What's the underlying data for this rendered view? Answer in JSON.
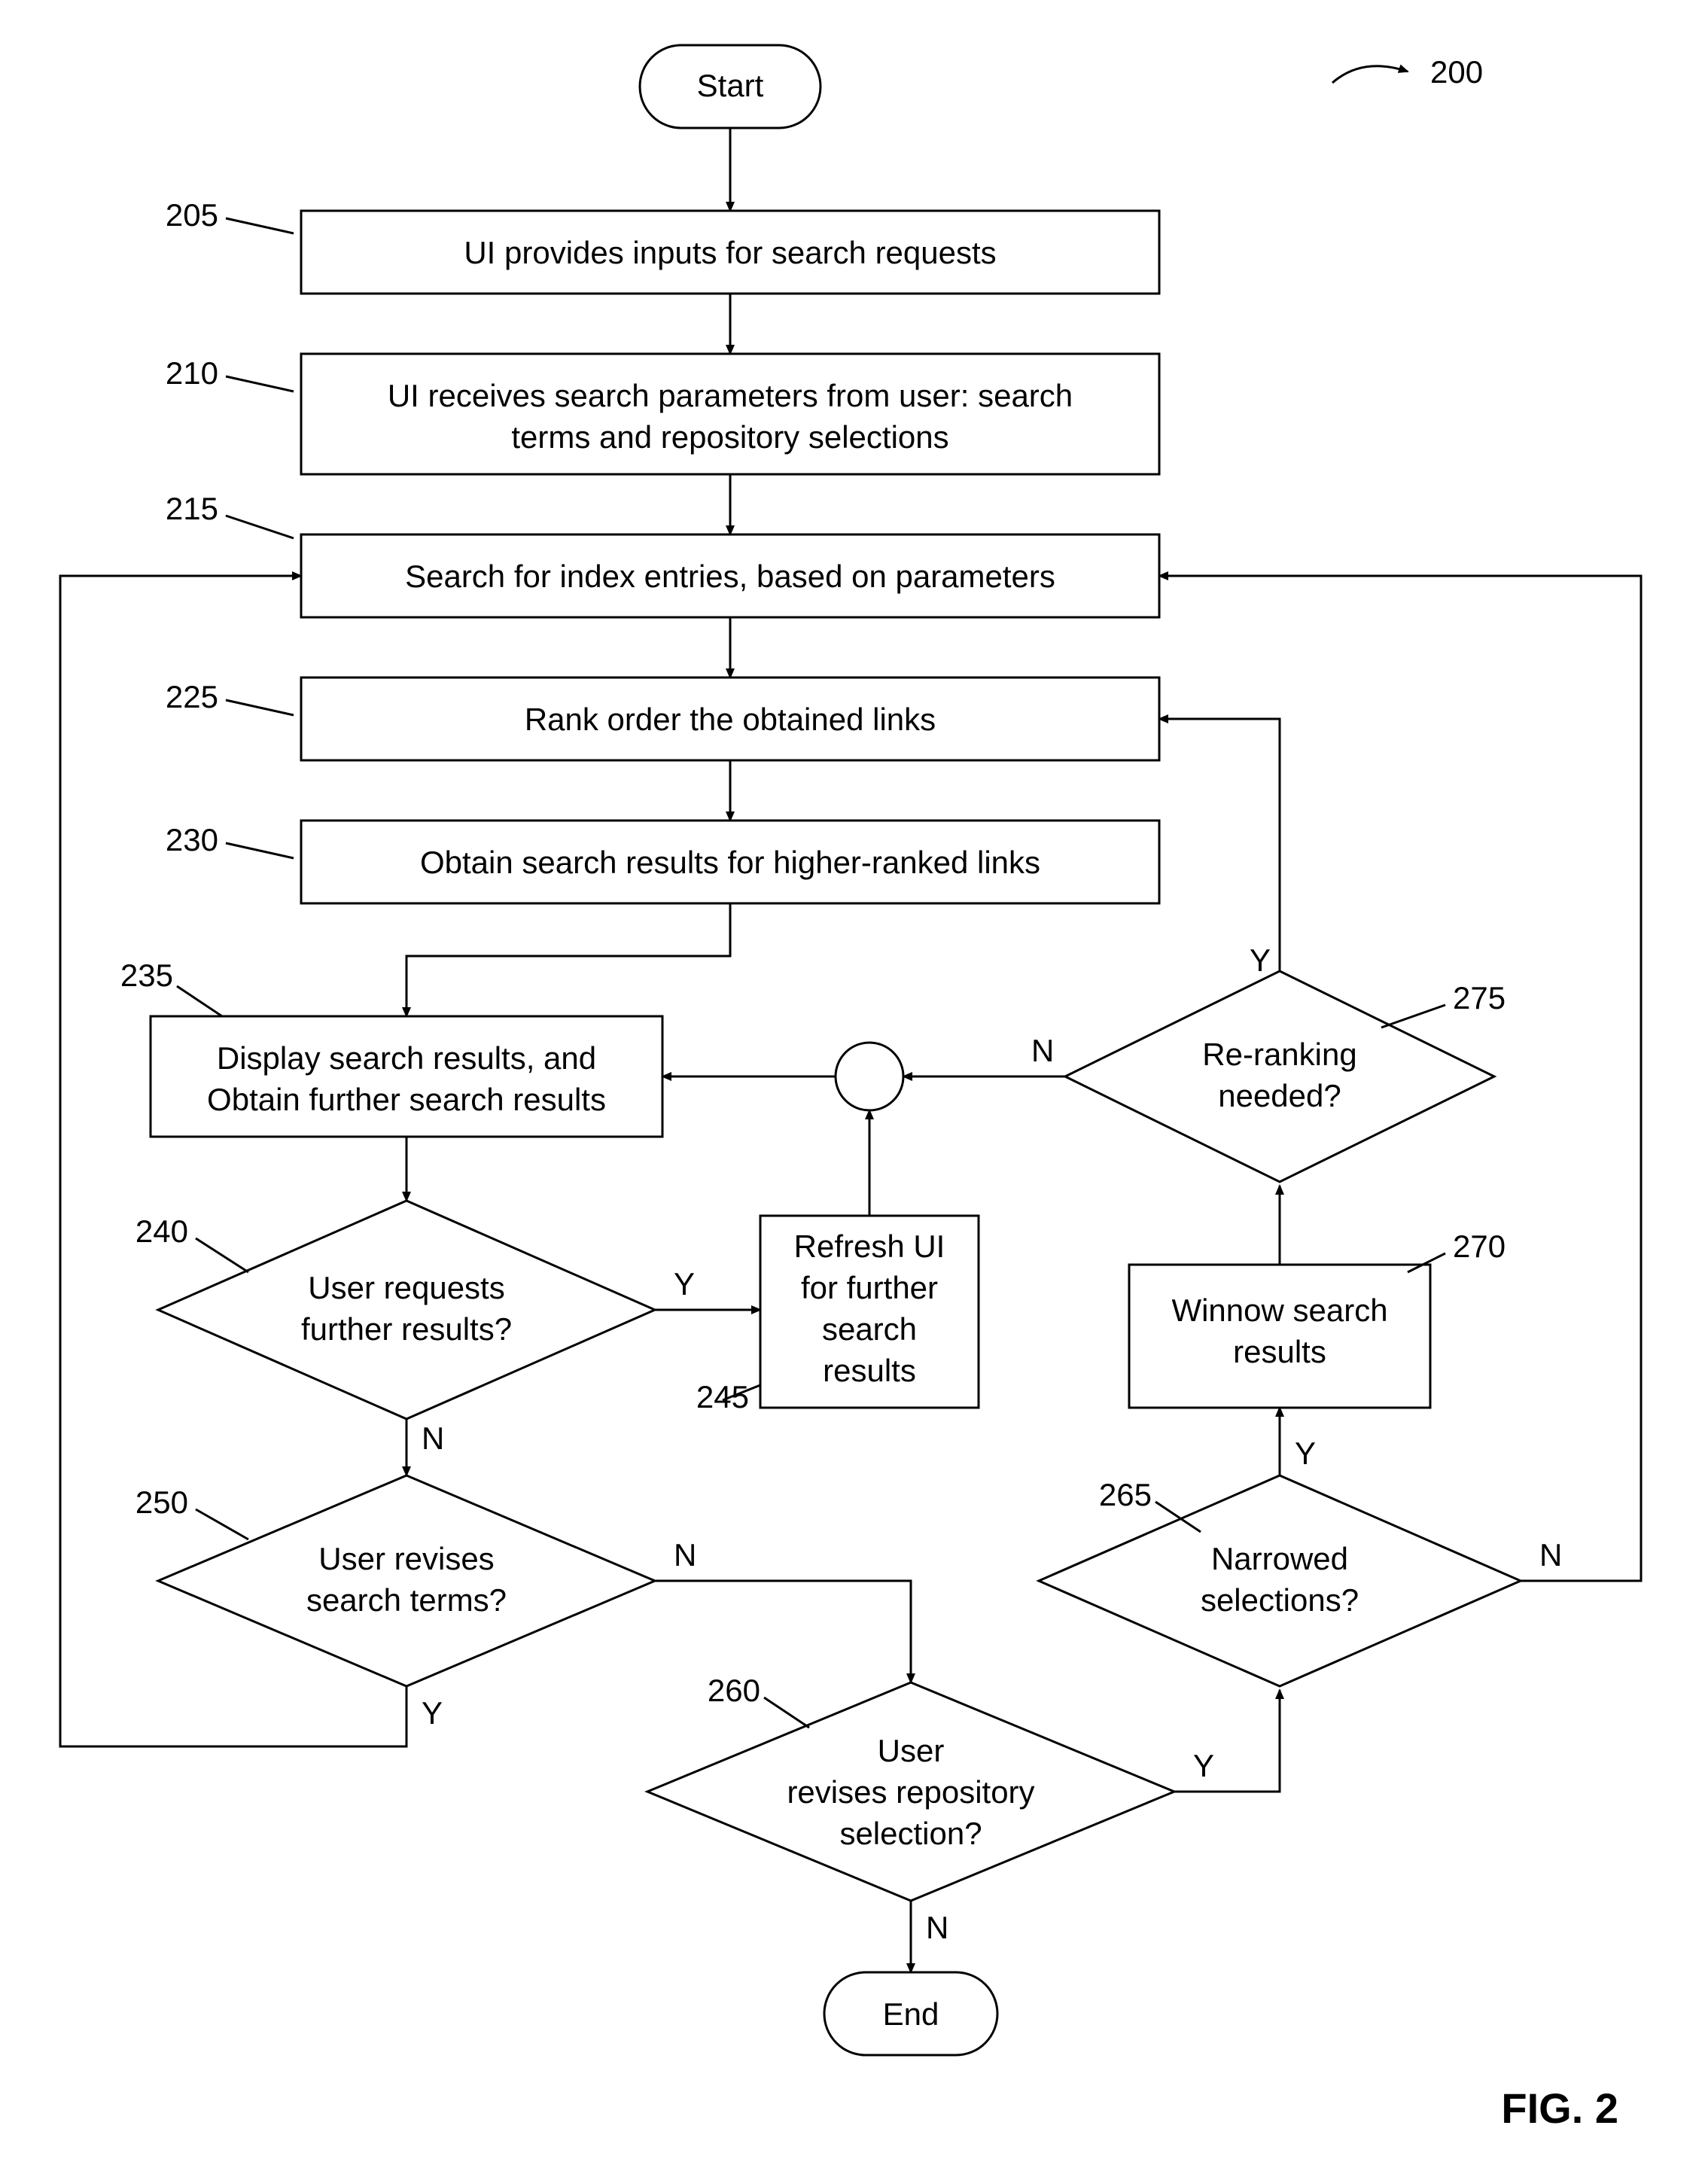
{
  "figure_label": "FIG. 2",
  "chart_data": {
    "type": "flowchart",
    "overall_ref": "200",
    "nodes": [
      {
        "id": "start",
        "kind": "terminator",
        "text": [
          "Start"
        ]
      },
      {
        "id": "205",
        "kind": "process",
        "ref": "205",
        "text": [
          "UI provides inputs for search requests"
        ]
      },
      {
        "id": "210",
        "kind": "process",
        "ref": "210",
        "text": [
          "UI receives search parameters from user: search",
          "terms and repository selections"
        ]
      },
      {
        "id": "215",
        "kind": "process",
        "ref": "215",
        "text": [
          "Search for index entries, based on parameters"
        ]
      },
      {
        "id": "225",
        "kind": "process",
        "ref": "225",
        "text": [
          "Rank order the obtained links"
        ]
      },
      {
        "id": "230",
        "kind": "process",
        "ref": "230",
        "text": [
          "Obtain search results for higher-ranked links"
        ]
      },
      {
        "id": "235",
        "kind": "process",
        "ref": "235",
        "text": [
          "Display search results, and",
          "Obtain further search results"
        ]
      },
      {
        "id": "240",
        "kind": "decision",
        "ref": "240",
        "text": [
          "User requests",
          "further results?"
        ]
      },
      {
        "id": "245",
        "kind": "process",
        "ref": "245",
        "text": [
          "Refresh UI",
          "for further",
          "search",
          "results"
        ]
      },
      {
        "id": "250",
        "kind": "decision",
        "ref": "250",
        "text": [
          "User revises",
          "search terms?"
        ]
      },
      {
        "id": "260",
        "kind": "decision",
        "ref": "260",
        "text": [
          "User",
          "revises repository",
          "selection?"
        ]
      },
      {
        "id": "265",
        "kind": "decision",
        "ref": "265",
        "text": [
          "Narrowed",
          "selections?"
        ]
      },
      {
        "id": "270",
        "kind": "process",
        "ref": "270",
        "text": [
          "Winnow search",
          "results"
        ]
      },
      {
        "id": "275",
        "kind": "decision",
        "ref": "275",
        "text": [
          "Re-ranking",
          "needed?"
        ]
      },
      {
        "id": "junction",
        "kind": "connector",
        "text": []
      },
      {
        "id": "end",
        "kind": "terminator",
        "text": [
          "End"
        ]
      }
    ],
    "edges": [
      {
        "from": "start",
        "to": "205"
      },
      {
        "from": "205",
        "to": "210"
      },
      {
        "from": "210",
        "to": "215"
      },
      {
        "from": "215",
        "to": "225"
      },
      {
        "from": "225",
        "to": "230"
      },
      {
        "from": "230",
        "to": "235"
      },
      {
        "from": "235",
        "to": "240"
      },
      {
        "from": "240",
        "to": "245",
        "label": "Y"
      },
      {
        "from": "245",
        "to": "junction"
      },
      {
        "from": "junction",
        "to": "235"
      },
      {
        "from": "240",
        "to": "250",
        "label": "N"
      },
      {
        "from": "250",
        "to": "215",
        "label": "Y"
      },
      {
        "from": "250",
        "to": "260",
        "label": "N"
      },
      {
        "from": "260",
        "to": "end",
        "label": "N"
      },
      {
        "from": "260",
        "to": "265",
        "label": "Y"
      },
      {
        "from": "265",
        "to": "215",
        "label": "N"
      },
      {
        "from": "265",
        "to": "270",
        "label": "Y"
      },
      {
        "from": "270",
        "to": "275"
      },
      {
        "from": "275",
        "to": "junction",
        "label": "N"
      },
      {
        "from": "275",
        "to": "225",
        "label": "Y"
      }
    ]
  }
}
